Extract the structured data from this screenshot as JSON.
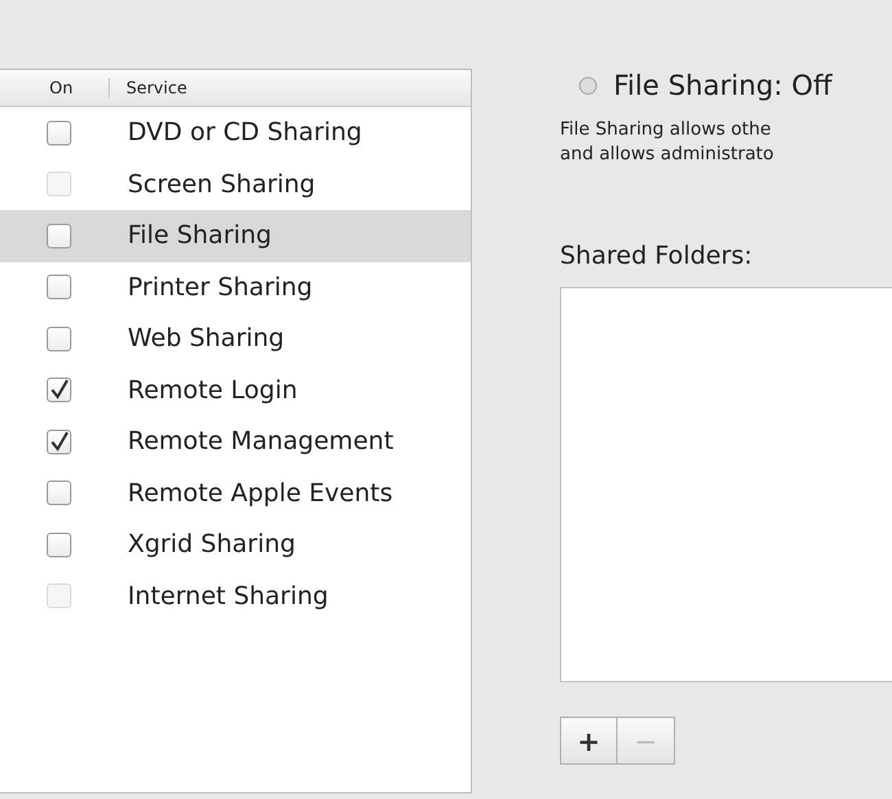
{
  "services": {
    "columns": [
      "On",
      "Service"
    ],
    "rows": [
      {
        "name": "DVD or CD Sharing",
        "checked": false,
        "disabled": false,
        "selected": false
      },
      {
        "name": "Screen Sharing",
        "checked": false,
        "disabled": true,
        "selected": false
      },
      {
        "name": "File Sharing",
        "checked": false,
        "disabled": false,
        "selected": true
      },
      {
        "name": "Printer Sharing",
        "checked": false,
        "disabled": false,
        "selected": false
      },
      {
        "name": "Web Sharing",
        "checked": false,
        "disabled": false,
        "selected": false
      },
      {
        "name": "Remote Login",
        "checked": true,
        "disabled": false,
        "selected": false
      },
      {
        "name": "Remote Management",
        "checked": true,
        "disabled": false,
        "selected": false
      },
      {
        "name": "Remote Apple Events",
        "checked": false,
        "disabled": false,
        "selected": false
      },
      {
        "name": "Xgrid Sharing",
        "checked": false,
        "disabled": false,
        "selected": false
      },
      {
        "name": "Internet Sharing",
        "checked": false,
        "disabled": true,
        "selected": false
      }
    ]
  },
  "detail": {
    "status": {
      "title": "File Sharing: Off",
      "on": false
    },
    "description_lines": [
      "File Sharing allows othe",
      "and allows administrato"
    ],
    "shared_folders_label": "Shared Folders:",
    "buttons": [
      {
        "label": "+",
        "disabled": false
      },
      {
        "label": "−",
        "disabled": true
      }
    ]
  }
}
